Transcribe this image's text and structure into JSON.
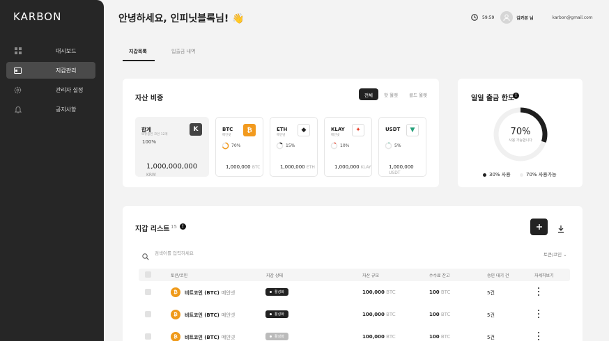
{
  "app": {
    "logo": "KARBON"
  },
  "sidebar": {
    "items": [
      {
        "label": "대시보드",
        "icon": "dashboard-icon",
        "active": false
      },
      {
        "label": "지갑관리",
        "icon": "wallet-icon",
        "active": true
      },
      {
        "label": "관리자 설정",
        "icon": "gear-icon",
        "active": false
      },
      {
        "label": "공지사항",
        "icon": "bell-icon",
        "active": false
      }
    ]
  },
  "header": {
    "greeting": "안녕하세요, 인피닛블록님! 👋",
    "timer": "59:59",
    "user_name": "김카본 님",
    "email": "karbon@gmail.com"
  },
  "tabs": [
    {
      "label": "지갑목록",
      "active": true
    },
    {
      "label": "입출금 내역",
      "active": false
    }
  ],
  "asset_ratio": {
    "title": "자산 비중",
    "filters": [
      {
        "label": "전체",
        "active": true
      },
      {
        "label": "핫 월렛",
        "active": false
      },
      {
        "label": "콜드 월렛",
        "active": false
      }
    ],
    "total": {
      "label": "합계",
      "sub": "보유중인 코인 12개",
      "percent": "100%",
      "amount": "1,000,000,000",
      "unit": "KRW",
      "icon_letter": "K"
    },
    "coins": [
      {
        "symbol": "BTC",
        "network": "메인넷",
        "percent": "70%",
        "ratio": 0.7,
        "amount": "1,000,000",
        "unit": "BTC",
        "icon": "bitcoin-icon",
        "icon_glyph": "₿",
        "color": "#f29a1e"
      },
      {
        "symbol": "ETH",
        "network": "메인넷",
        "percent": "15%",
        "ratio": 0.15,
        "amount": "1,000,000",
        "unit": "ETH",
        "icon": "ethereum-icon",
        "icon_glyph": "◆",
        "color": "#222222"
      },
      {
        "symbol": "KLAY",
        "network": "메인넷",
        "percent": "10%",
        "ratio": 0.1,
        "amount": "1,000,000",
        "unit": "KLAY",
        "icon": "klaytn-icon",
        "icon_glyph": "✦",
        "color": "#e63a24"
      },
      {
        "symbol": "USDT",
        "network": "",
        "percent": "5%",
        "ratio": 0.05,
        "amount": "1,000,000",
        "unit": "USDT",
        "icon": "tether-icon",
        "icon_glyph": "▼",
        "color": "#26a17b"
      }
    ]
  },
  "daily_limit": {
    "title": "일일 출금 한도",
    "percent": "70%",
    "sub": "사용 가능합니다",
    "used_ratio": 0.3,
    "legend_used": "30% 사용",
    "legend_available": "70% 사용가능"
  },
  "wallet_list": {
    "title": "지갑 리스트",
    "count": "15",
    "search_placeholder": "검색어를 입력하세요",
    "filter_label": "토큰/코인",
    "columns": [
      "토큰/코인",
      "지갑 상태",
      "자산 규모",
      "수수료 잔고",
      "승인 대기 건",
      "자세히보기"
    ],
    "rows": [
      {
        "name": "비트코인 (BTC)",
        "network": "메인넷",
        "status": "활성화",
        "active": true,
        "asset": "100,000",
        "asset_unit": "BTC",
        "fee": "100",
        "fee_unit": "BTC",
        "pending": "5건"
      },
      {
        "name": "비트코인 (BTC)",
        "network": "메인넷",
        "status": "활성화",
        "active": true,
        "asset": "100,000",
        "asset_unit": "BTC",
        "fee": "100",
        "fee_unit": "BTC",
        "pending": "5건"
      },
      {
        "name": "비트코인 (BTC)",
        "network": "메인넷",
        "status": "활성화",
        "active": false,
        "asset": "100,000",
        "asset_unit": "BTC",
        "fee": "100",
        "fee_unit": "BTC",
        "pending": "5건"
      }
    ]
  }
}
